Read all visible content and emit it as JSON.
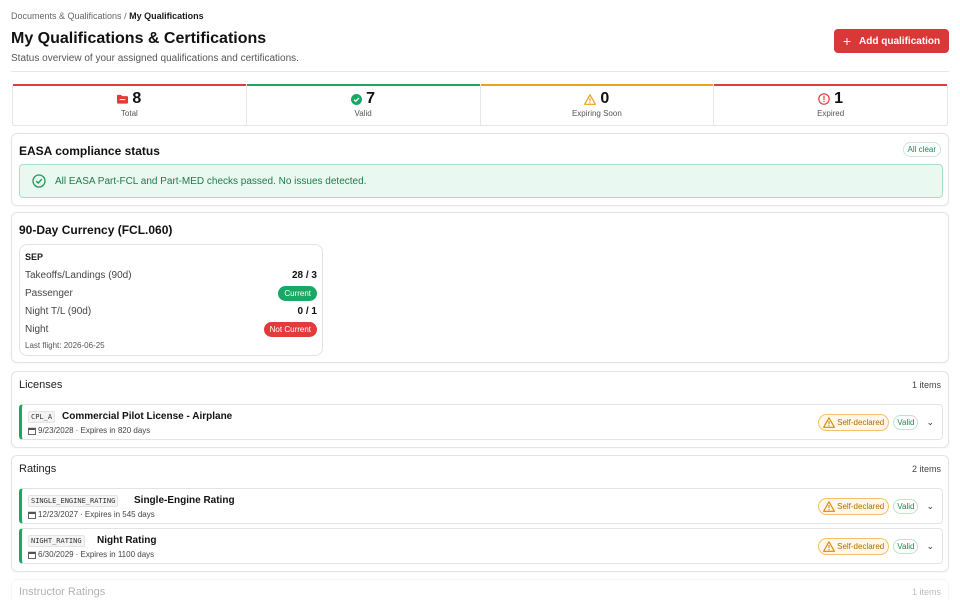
{
  "breadcrumb": {
    "parent": "Documents & Qualifications",
    "sep": " / ",
    "current": "My Qualifications"
  },
  "header": {
    "title": "My Qualifications & Certifications",
    "subtitle": "Status overview of your assigned qualifications and certifications.",
    "add_label": "Add qualification",
    "add_icon": "+"
  },
  "stats": [
    {
      "value": "8",
      "label": "Total",
      "icon": "folder-icon",
      "color": "#e23b3b"
    },
    {
      "value": "7",
      "label": "Valid",
      "icon": "check-circle-icon",
      "color": "#17a863"
    },
    {
      "value": "0",
      "label": "Expiring Soon",
      "icon": "warning-icon",
      "color": "#e8a317"
    },
    {
      "value": "1",
      "label": "Expired",
      "icon": "alert-circle-icon",
      "color": "#e23b3b"
    }
  ],
  "compliance": {
    "title": "EASA compliance status",
    "badge": "All clear",
    "message": "All EASA Part-FCL and Part-MED checks passed. No issues detected."
  },
  "currency": {
    "title": "90-Day Currency (FCL.060)",
    "category": "SEP",
    "rows": [
      {
        "label": "Takeoffs/Landings (90d)",
        "value": "28 / 3"
      },
      {
        "label": "Passenger",
        "value": "Current"
      },
      {
        "label": "Night T/L (90d)",
        "value": "0 / 1"
      },
      {
        "label": "Night",
        "value": "Not Current"
      }
    ],
    "last_flight": "Last flight: 2026-06-25"
  },
  "licenses": {
    "title": "Licenses",
    "count": "1 items",
    "items": [
      {
        "code": "CPL_A",
        "name": "Commercial Pilot License - Airplane",
        "date": "9/23/2028",
        "expires": "· Expires in 820 days",
        "declared": "Self-declared",
        "status": "Valid"
      }
    ]
  },
  "ratings": {
    "title": "Ratings",
    "count": "2 items",
    "items": [
      {
        "code": "SINGLE_ENGINE_RATING",
        "name": "Single-Engine Rating",
        "date": "12/23/2027",
        "expires": "· Expires in 545 days",
        "declared": "Self-declared",
        "status": "Valid"
      },
      {
        "code": "NIGHT_RATING",
        "name": "Night Rating",
        "date": "6/30/2029",
        "expires": "· Expires in 1100 days",
        "declared": "Self-declared",
        "status": "Valid"
      }
    ]
  },
  "instructor": {
    "title": "Instructor Ratings",
    "count": "1 items"
  }
}
